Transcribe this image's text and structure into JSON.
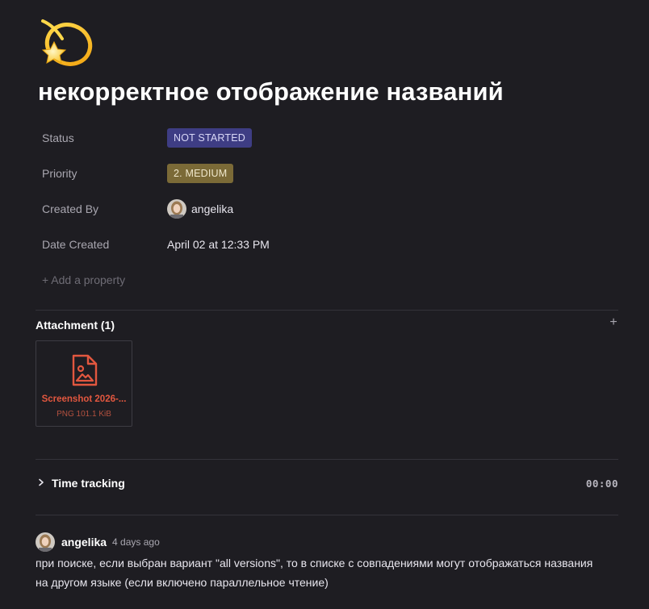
{
  "page": {
    "icon": "shooting-star-emoji",
    "title": "некорректное отображение названий"
  },
  "properties": [
    {
      "label": "Status",
      "value": "NOT STARTED",
      "color": "#3e3d84"
    },
    {
      "label": "Priority",
      "value": "2. MEDIUM",
      "color": "#7b6a37"
    },
    {
      "label": "Created By",
      "value": "angelika"
    },
    {
      "label": "Date Created",
      "value": "April 02 at 12:33 PM"
    }
  ],
  "add_property_label": "+ Add a property",
  "attachments": {
    "title": "Attachment (1)",
    "add_icon": "plus-icon",
    "items": [
      {
        "name": "Screenshot 2026-...",
        "meta": "PNG 101.1 KiB",
        "icon": "image-file-icon",
        "color": "#e2573f"
      }
    ]
  },
  "time_tracking": {
    "label": "Time tracking",
    "value": "00:00",
    "icon": "chevron-right-icon"
  },
  "comment": {
    "author": "angelika",
    "time": "4 days ago",
    "text": "при поиске, если выбран вариант \"all versions\", то в списке с совпадениями могут отображаться названия на другом языке (если включено параллельное чтение)"
  }
}
